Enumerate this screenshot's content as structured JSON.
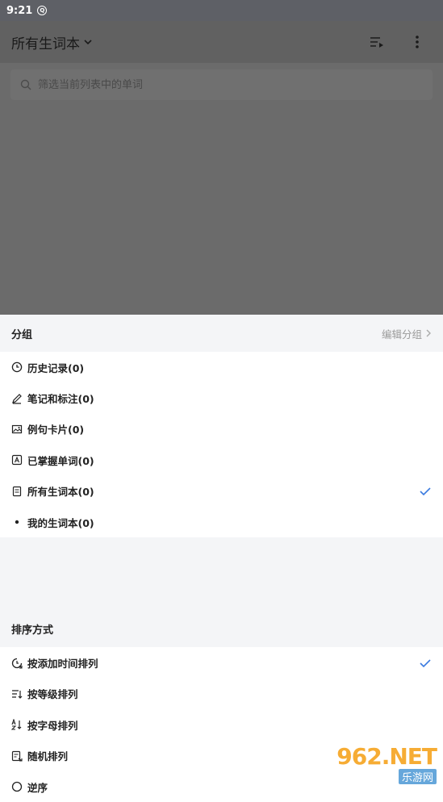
{
  "status_bar": {
    "time": "9:21"
  },
  "app_bar": {
    "title": "所有生词本",
    "icons": [
      "sort-list-icon",
      "more-vertical-icon"
    ]
  },
  "search": {
    "placeholder": "筛选当前列表中的单词"
  },
  "groups": {
    "header": "分组",
    "edit_label": "编辑分组",
    "items": [
      {
        "label": "历史记录(0)",
        "icon": "clock-icon",
        "checked": false
      },
      {
        "label": "笔记和标注(0)",
        "icon": "pencil-icon",
        "checked": false
      },
      {
        "label": "例句卡片(0)",
        "icon": "image-icon",
        "checked": false
      },
      {
        "label": "已掌握单词(0)",
        "icon": "mastered-icon",
        "checked": false
      },
      {
        "label": "所有生词本(0)",
        "icon": "wordbook-icon",
        "checked": true
      },
      {
        "label": "我的生词本(0)",
        "icon": "dot-icon",
        "checked": false
      }
    ]
  },
  "sort": {
    "header": "排序方式",
    "items": [
      {
        "label": "按添加时间排列",
        "icon": "time-sort-icon",
        "checked": true
      },
      {
        "label": "按等级排列",
        "icon": "level-sort-icon",
        "checked": false
      },
      {
        "label": "按字母排列",
        "icon": "alpha-sort-icon",
        "checked": false
      },
      {
        "label": "随机排列",
        "icon": "random-sort-icon",
        "checked": false
      },
      {
        "label": "逆序",
        "icon": "reverse-icon",
        "checked": false
      }
    ]
  },
  "watermark": {
    "number": "962.NET",
    "text": "乐游网"
  },
  "colors": {
    "check": "#3b7be0",
    "overlay": "#6b6b6b"
  }
}
